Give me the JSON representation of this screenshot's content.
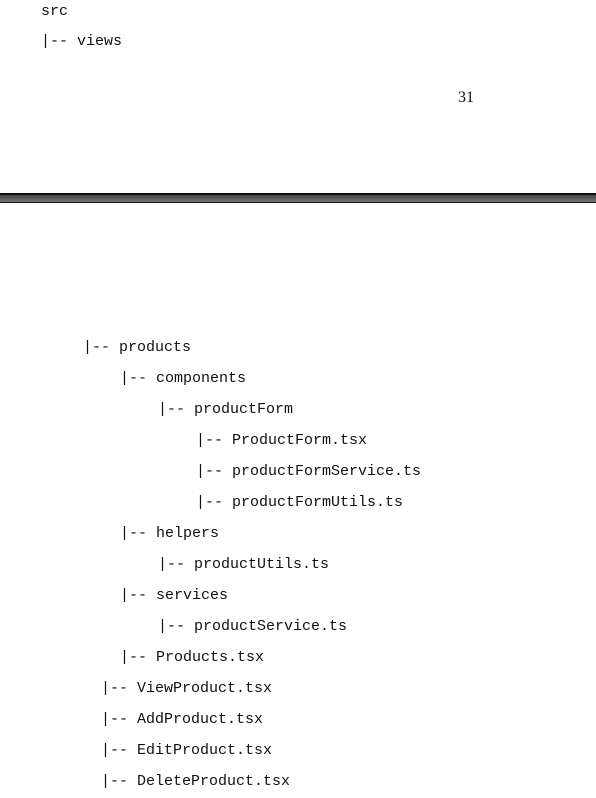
{
  "top_tree": [
    "src",
    "|-- views"
  ],
  "page_number": "31",
  "tree": [
    "|-- products",
    "|-- components",
    "|-- productForm",
    "|-- ProductForm.tsx",
    "|-- productFormService.ts",
    "|-- productFormUtils.ts",
    "|-- helpers",
    "|-- productUtils.ts",
    "|-- services",
    "|-- productService.ts",
    "|-- Products.tsx",
    "|-- ViewProduct.tsx",
    "|-- AddProduct.tsx",
    "|-- EditProduct.tsx",
    "|-- DeleteProduct.tsx"
  ]
}
